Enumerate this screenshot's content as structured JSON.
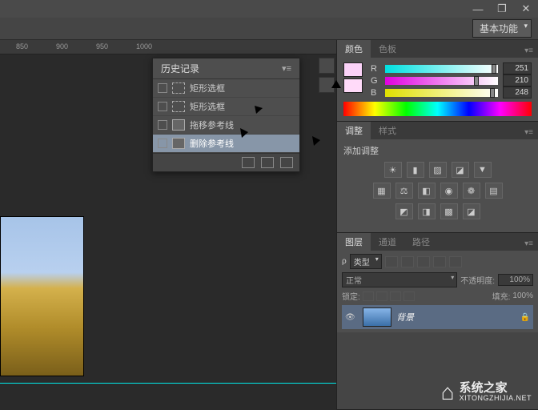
{
  "titlebar": {
    "min": "—",
    "restore": "❐",
    "close": "✕"
  },
  "workspace": {
    "label": "基本功能"
  },
  "ruler": {
    "ticks": [
      850,
      900,
      950,
      1000
    ]
  },
  "history": {
    "title": "历史记录",
    "items": [
      {
        "label": "矩形选框"
      },
      {
        "label": "矩形选框"
      },
      {
        "label": "拖移参考线"
      },
      {
        "label": "删除参考线"
      }
    ]
  },
  "color": {
    "tab1": "颜色",
    "tab2": "色板",
    "r_label": "R",
    "g_label": "G",
    "b_label": "B",
    "r": "251",
    "g": "210",
    "b": "248",
    "fg": "#fbd2f8",
    "bg": "#ffdaf9"
  },
  "adjust": {
    "tab1": "调整",
    "tab2": "样式",
    "title": "添加调整",
    "row1": [
      "☀",
      "▮",
      "▨",
      "◪",
      "▼"
    ],
    "row2": [
      "▦",
      "⚖",
      "◧",
      "◉",
      "❁",
      "▤"
    ],
    "row3": [
      "◩",
      "◨",
      "▩",
      "◪"
    ]
  },
  "layers": {
    "tab1": "图层",
    "tab2": "通道",
    "tab3": "路径",
    "filter": "类型",
    "blend": "正常",
    "opac_label": "不透明度:",
    "opac": "100%",
    "lock_label": "锁定:",
    "fill_label": "填充:",
    "fill": "100%",
    "layer_name": "背景"
  },
  "watermark": {
    "cn": "系统之家",
    "en": "XITONGZHIJIA.NET"
  },
  "suffix_pct": "%"
}
